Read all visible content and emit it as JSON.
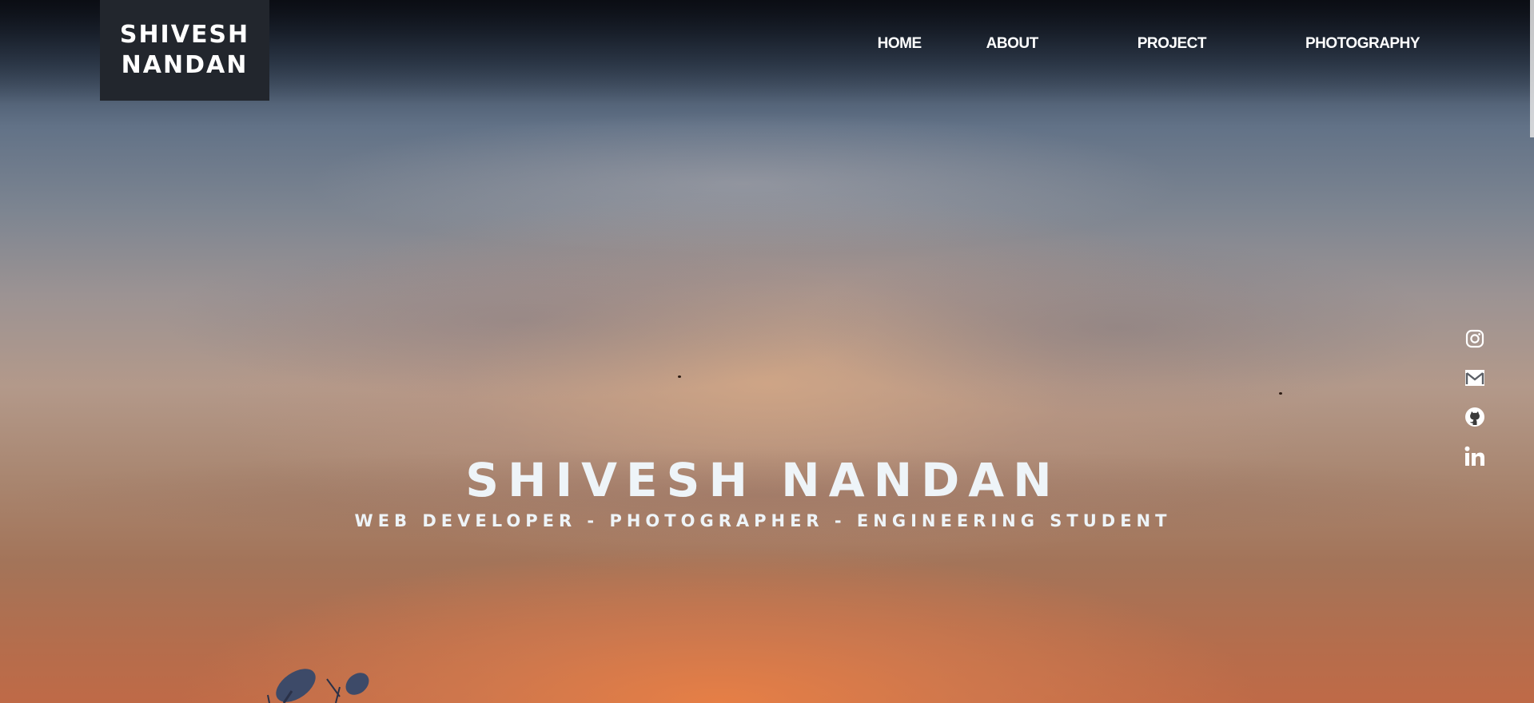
{
  "header": {
    "logo_line1": "SHIVESH",
    "logo_line2": "NANDAN",
    "nav": [
      "HOME",
      "ABOUT",
      "PROJECT",
      "PHOTOGRAPHY"
    ]
  },
  "social": {
    "icons": [
      "instagram-icon",
      "mail-icon",
      "github-icon",
      "linkedin-icon"
    ]
  },
  "hero": {
    "title": "SHIVESH NANDAN",
    "subtitle": "WEB DEVELOPER - PHOTOGRAPHER - ENGINEERING STUDENT"
  },
  "colors": {
    "logo_bg": "#22262d",
    "text": "#ffffff",
    "hero_text": "#eef4f8"
  }
}
